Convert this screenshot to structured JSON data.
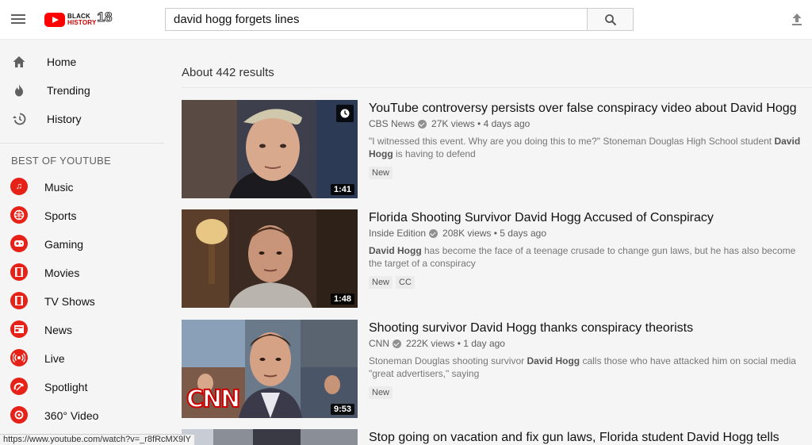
{
  "header": {
    "logo": {
      "line1": "BLACK",
      "line2": "HISTORY",
      "year": "18"
    },
    "search_value": "david hogg forgets lines"
  },
  "sidebar": {
    "nav": [
      {
        "label": "Home",
        "icon": "home-icon"
      },
      {
        "label": "Trending",
        "icon": "flame-icon"
      },
      {
        "label": "History",
        "icon": "history-icon"
      }
    ],
    "section_title": "BEST OF YOUTUBE",
    "categories": [
      {
        "label": "Music",
        "icon": "music-icon"
      },
      {
        "label": "Sports",
        "icon": "sports-icon"
      },
      {
        "label": "Gaming",
        "icon": "gaming-icon"
      },
      {
        "label": "Movies",
        "icon": "movies-icon"
      },
      {
        "label": "TV Shows",
        "icon": "tv-shows-icon"
      },
      {
        "label": "News",
        "icon": "news-icon"
      },
      {
        "label": "Live",
        "icon": "live-icon"
      },
      {
        "label": "Spotlight",
        "icon": "spotlight-icon"
      },
      {
        "label": "360° Video",
        "icon": "360-video-icon"
      }
    ],
    "accent_color": "#e62117"
  },
  "results": {
    "count_text": "About 442 results",
    "videos": [
      {
        "title": "YouTube controversy persists over false conspiracy video about David Hogg",
        "channel": "CBS News",
        "views": "27K views",
        "age": "4 days ago",
        "desc_pre": "\"I witnessed this event. Why are you doing this to me?\" Stoneman Douglas High School student ",
        "desc_bold": "David Hogg",
        "desc_post": " is having to defend",
        "duration": "1:41",
        "badges": [
          "New"
        ]
      },
      {
        "title": "Florida Shooting Survivor David Hogg Accused of Conspiracy",
        "channel": "Inside Edition",
        "views": "208K views",
        "age": "5 days ago",
        "desc_pre": "",
        "desc_bold": "David Hogg",
        "desc_post": " has become the face of a teenage crusade to change gun laws, but he has also become the target of a conspiracy",
        "duration": "1:48",
        "badges": [
          "New",
          "CC"
        ]
      },
      {
        "title": "Shooting survivor David Hogg thanks conspiracy theorists",
        "channel": "CNN",
        "views": "222K views",
        "age": "1 day ago",
        "desc_pre": "Stoneman Douglas shooting survivor ",
        "desc_bold": "David Hogg",
        "desc_post": " calls those who have attacked him on social media \"great advertisers,\" saying",
        "duration": "9:53",
        "badges": [
          "New"
        ],
        "overlay": "CNN"
      },
      {
        "title": "Stop going on vacation and fix gun laws, Florida student David Hogg tells"
      }
    ]
  },
  "status_url": "https://www.youtube.com/watch?v=_r8fRcMX9lY"
}
